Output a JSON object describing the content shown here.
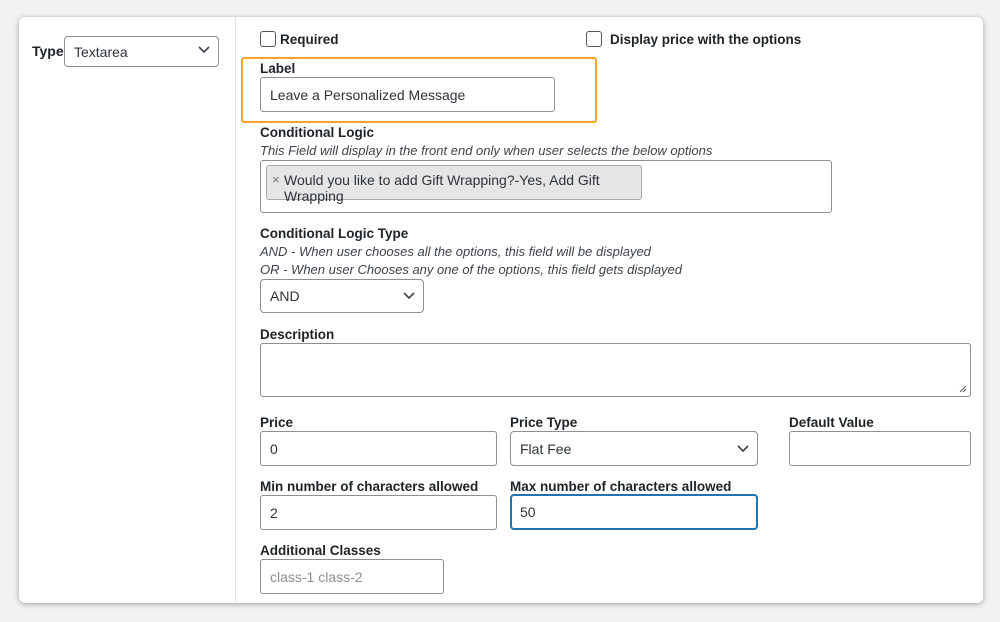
{
  "type_field": {
    "label": "Type",
    "value": "Textarea"
  },
  "required": {
    "label": "Required",
    "checked": false
  },
  "display_price": {
    "label": "Display price with the options",
    "checked": false
  },
  "label_field": {
    "label": "Label",
    "value": "Leave a Personalized Message"
  },
  "conditional_logic": {
    "label": "Conditional Logic",
    "hint": "This Field will display in the front end only when user selects the below options",
    "chips": [
      {
        "remove": "×",
        "text": "Would you like to add Gift Wrapping?-Yes, Add Gift Wrapping"
      }
    ]
  },
  "conditional_logic_type": {
    "label": "Conditional Logic Type",
    "hint_and": "AND - When user chooses all the options, this field will be displayed",
    "hint_or": "OR - When user Chooses any one of the options, this field gets displayed",
    "value": "AND"
  },
  "description": {
    "label": "Description",
    "value": ""
  },
  "price": {
    "label": "Price",
    "value": "0"
  },
  "price_type": {
    "label": "Price Type",
    "value": "Flat Fee"
  },
  "default_value": {
    "label": "Default Value",
    "value": ""
  },
  "min_chars": {
    "label": "Min number of characters allowed",
    "value": "2"
  },
  "max_chars": {
    "label": "Max number of characters allowed",
    "value": "50"
  },
  "additional_classes": {
    "label": "Additional Classes",
    "placeholder": "class-1 class-2",
    "value": ""
  },
  "colors": {
    "highlight": "#f5a623",
    "focus": "#2271b1"
  }
}
